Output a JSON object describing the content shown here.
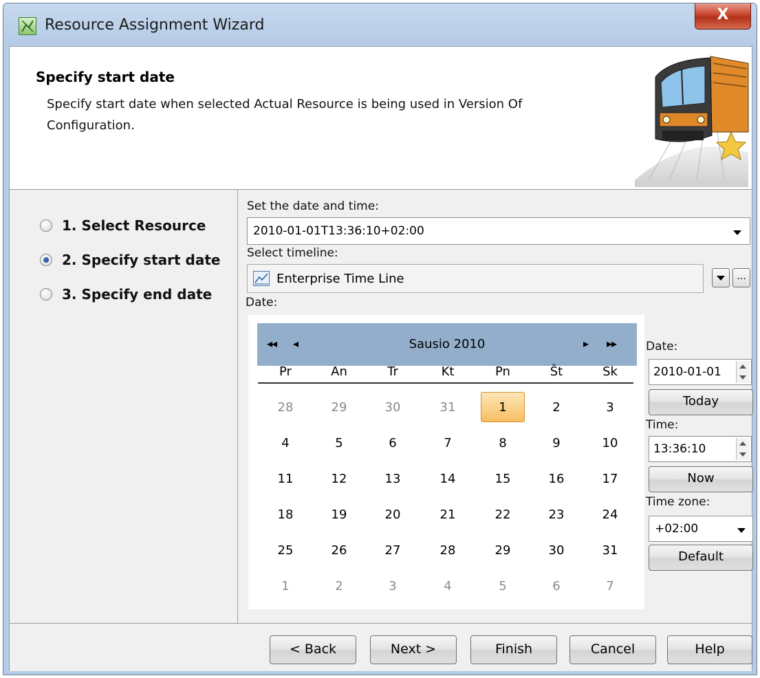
{
  "window": {
    "title": "Resource Assignment Wizard",
    "close_glyph": "X"
  },
  "header": {
    "title": "Specify start date",
    "description": "Specify start date when selected Actual Resource is being used in Version Of Configuration."
  },
  "steps": [
    {
      "label": "1. Select Resource",
      "checked": false
    },
    {
      "label": "2. Specify start date",
      "checked": true
    },
    {
      "label": "3. Specify end date",
      "checked": false
    }
  ],
  "form": {
    "datetime_label": "Set the date and time:",
    "datetime_value": "2010-01-01T13:36:10+02:00",
    "timeline_label": "Select timeline:",
    "timeline_value": "Enterprise Time Line",
    "more_button": "...",
    "date_label": "Date:"
  },
  "calendar": {
    "nav_prev_year": "◂◂",
    "nav_prev_month": "◂",
    "nav_next_month": "▸",
    "nav_next_year": "▸▸",
    "month_label": "Sausio  2010",
    "weekdays": [
      "Pr",
      "An",
      "Tr",
      "Kt",
      "Pn",
      "Št",
      "Sk"
    ],
    "weeks": [
      [
        "28",
        "29",
        "30",
        "31",
        "1",
        "2",
        "3"
      ],
      [
        "4",
        "5",
        "6",
        "7",
        "8",
        "9",
        "10"
      ],
      [
        "11",
        "12",
        "13",
        "14",
        "15",
        "16",
        "17"
      ],
      [
        "18",
        "19",
        "20",
        "21",
        "22",
        "23",
        "24"
      ],
      [
        "25",
        "26",
        "27",
        "28",
        "29",
        "30",
        "31"
      ],
      [
        "1",
        "2",
        "3",
        "4",
        "5",
        "6",
        "7"
      ]
    ],
    "selected_day": "1"
  },
  "side": {
    "date_label": "Date:",
    "date_value": "2010-01-01",
    "today_button": "Today",
    "time_label": "Time:",
    "time_value": "13:36:10",
    "now_button": "Now",
    "timezone_label": "Time zone:",
    "timezone_value": "+02:00",
    "default_button": "Default"
  },
  "footer": {
    "back": "< Back",
    "next": "Next >",
    "finish": "Finish",
    "cancel": "Cancel",
    "help": "Help"
  },
  "colors": {
    "calendar_header": "#92aecb",
    "selected_day": "#f7be62",
    "title_bar": "#b5cbe6",
    "close_button": "#c7432b"
  }
}
